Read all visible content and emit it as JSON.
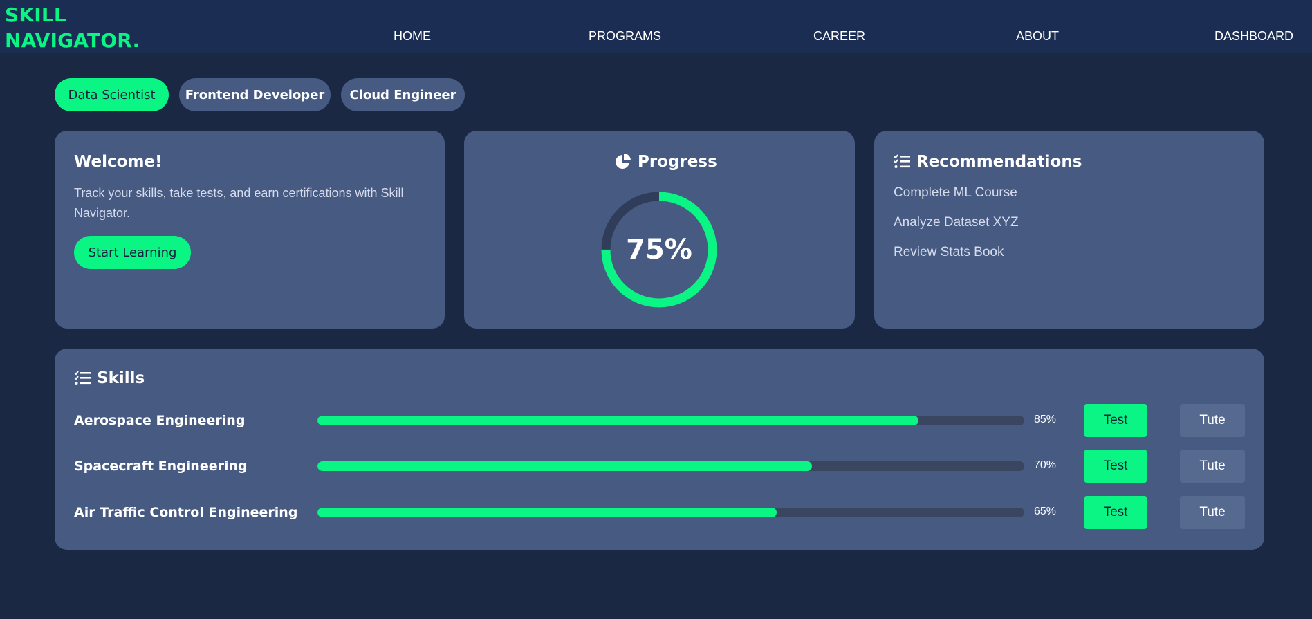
{
  "brand": {
    "line1": "SKILL",
    "line2": "NAVIGATOR."
  },
  "nav": {
    "home": "HOME",
    "programs": "PROGRAMS",
    "career": "CAREER",
    "about": "ABOUT",
    "dashboard": "DASHBOARD"
  },
  "roles": [
    {
      "label": "Data Scientist",
      "active": true
    },
    {
      "label": "Frontend Developer",
      "active": false
    },
    {
      "label": "Cloud Engineer",
      "active": false
    }
  ],
  "welcome": {
    "title": "Welcome!",
    "text": "Track your skills, take tests, and earn certifications with Skill Navigator.",
    "button": "Start Learning"
  },
  "progress": {
    "title": "Progress",
    "icon": "pie-chart-icon",
    "value_label": "75%",
    "value": 0.75
  },
  "recommendations": {
    "title": "Recommendations",
    "icon": "checklist-icon",
    "items": [
      "Complete ML Course",
      "Analyze Dataset XYZ",
      "Review Stats Book"
    ]
  },
  "skills": {
    "title": "Skills",
    "icon": "checklist-icon",
    "items": [
      {
        "name": "Aerospace Engineering",
        "percent_label": "85%",
        "value": 0.85,
        "test": "Test",
        "tute": "Tute"
      },
      {
        "name": "Spacecraft Engineering",
        "percent_label": "70%",
        "value": 0.7,
        "test": "Test",
        "tute": "Tute"
      },
      {
        "name": "Air Traffic Control Engineering",
        "percent_label": "65%",
        "value": 0.65,
        "test": "Test",
        "tute": "Tute"
      }
    ]
  },
  "colors": {
    "accent": "#0bf585",
    "background": "#1b2844",
    "header": "#1b2d52",
    "card": "#465a82",
    "track": "#3a4660",
    "ring_track": "#2f3d5a"
  }
}
